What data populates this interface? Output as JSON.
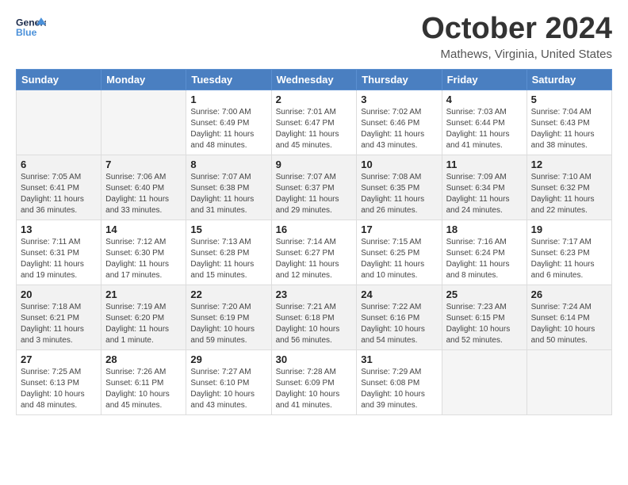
{
  "header": {
    "logo_general": "General",
    "logo_blue": "Blue",
    "month": "October 2024",
    "location": "Mathews, Virginia, United States"
  },
  "days_of_week": [
    "Sunday",
    "Monday",
    "Tuesday",
    "Wednesday",
    "Thursday",
    "Friday",
    "Saturday"
  ],
  "weeks": [
    [
      {
        "day": "",
        "sunrise": "",
        "sunset": "",
        "daylight": "",
        "empty": true
      },
      {
        "day": "",
        "sunrise": "",
        "sunset": "",
        "daylight": "",
        "empty": true
      },
      {
        "day": "1",
        "sunrise": "Sunrise: 7:00 AM",
        "sunset": "Sunset: 6:49 PM",
        "daylight": "Daylight: 11 hours and 48 minutes."
      },
      {
        "day": "2",
        "sunrise": "Sunrise: 7:01 AM",
        "sunset": "Sunset: 6:47 PM",
        "daylight": "Daylight: 11 hours and 45 minutes."
      },
      {
        "day": "3",
        "sunrise": "Sunrise: 7:02 AM",
        "sunset": "Sunset: 6:46 PM",
        "daylight": "Daylight: 11 hours and 43 minutes."
      },
      {
        "day": "4",
        "sunrise": "Sunrise: 7:03 AM",
        "sunset": "Sunset: 6:44 PM",
        "daylight": "Daylight: 11 hours and 41 minutes."
      },
      {
        "day": "5",
        "sunrise": "Sunrise: 7:04 AM",
        "sunset": "Sunset: 6:43 PM",
        "daylight": "Daylight: 11 hours and 38 minutes."
      }
    ],
    [
      {
        "day": "6",
        "sunrise": "Sunrise: 7:05 AM",
        "sunset": "Sunset: 6:41 PM",
        "daylight": "Daylight: 11 hours and 36 minutes."
      },
      {
        "day": "7",
        "sunrise": "Sunrise: 7:06 AM",
        "sunset": "Sunset: 6:40 PM",
        "daylight": "Daylight: 11 hours and 33 minutes."
      },
      {
        "day": "8",
        "sunrise": "Sunrise: 7:07 AM",
        "sunset": "Sunset: 6:38 PM",
        "daylight": "Daylight: 11 hours and 31 minutes."
      },
      {
        "day": "9",
        "sunrise": "Sunrise: 7:07 AM",
        "sunset": "Sunset: 6:37 PM",
        "daylight": "Daylight: 11 hours and 29 minutes."
      },
      {
        "day": "10",
        "sunrise": "Sunrise: 7:08 AM",
        "sunset": "Sunset: 6:35 PM",
        "daylight": "Daylight: 11 hours and 26 minutes."
      },
      {
        "day": "11",
        "sunrise": "Sunrise: 7:09 AM",
        "sunset": "Sunset: 6:34 PM",
        "daylight": "Daylight: 11 hours and 24 minutes."
      },
      {
        "day": "12",
        "sunrise": "Sunrise: 7:10 AM",
        "sunset": "Sunset: 6:32 PM",
        "daylight": "Daylight: 11 hours and 22 minutes."
      }
    ],
    [
      {
        "day": "13",
        "sunrise": "Sunrise: 7:11 AM",
        "sunset": "Sunset: 6:31 PM",
        "daylight": "Daylight: 11 hours and 19 minutes."
      },
      {
        "day": "14",
        "sunrise": "Sunrise: 7:12 AM",
        "sunset": "Sunset: 6:30 PM",
        "daylight": "Daylight: 11 hours and 17 minutes."
      },
      {
        "day": "15",
        "sunrise": "Sunrise: 7:13 AM",
        "sunset": "Sunset: 6:28 PM",
        "daylight": "Daylight: 11 hours and 15 minutes."
      },
      {
        "day": "16",
        "sunrise": "Sunrise: 7:14 AM",
        "sunset": "Sunset: 6:27 PM",
        "daylight": "Daylight: 11 hours and 12 minutes."
      },
      {
        "day": "17",
        "sunrise": "Sunrise: 7:15 AM",
        "sunset": "Sunset: 6:25 PM",
        "daylight": "Daylight: 11 hours and 10 minutes."
      },
      {
        "day": "18",
        "sunrise": "Sunrise: 7:16 AM",
        "sunset": "Sunset: 6:24 PM",
        "daylight": "Daylight: 11 hours and 8 minutes."
      },
      {
        "day": "19",
        "sunrise": "Sunrise: 7:17 AM",
        "sunset": "Sunset: 6:23 PM",
        "daylight": "Daylight: 11 hours and 6 minutes."
      }
    ],
    [
      {
        "day": "20",
        "sunrise": "Sunrise: 7:18 AM",
        "sunset": "Sunset: 6:21 PM",
        "daylight": "Daylight: 11 hours and 3 minutes."
      },
      {
        "day": "21",
        "sunrise": "Sunrise: 7:19 AM",
        "sunset": "Sunset: 6:20 PM",
        "daylight": "Daylight: 11 hours and 1 minute."
      },
      {
        "day": "22",
        "sunrise": "Sunrise: 7:20 AM",
        "sunset": "Sunset: 6:19 PM",
        "daylight": "Daylight: 10 hours and 59 minutes."
      },
      {
        "day": "23",
        "sunrise": "Sunrise: 7:21 AM",
        "sunset": "Sunset: 6:18 PM",
        "daylight": "Daylight: 10 hours and 56 minutes."
      },
      {
        "day": "24",
        "sunrise": "Sunrise: 7:22 AM",
        "sunset": "Sunset: 6:16 PM",
        "daylight": "Daylight: 10 hours and 54 minutes."
      },
      {
        "day": "25",
        "sunrise": "Sunrise: 7:23 AM",
        "sunset": "Sunset: 6:15 PM",
        "daylight": "Daylight: 10 hours and 52 minutes."
      },
      {
        "day": "26",
        "sunrise": "Sunrise: 7:24 AM",
        "sunset": "Sunset: 6:14 PM",
        "daylight": "Daylight: 10 hours and 50 minutes."
      }
    ],
    [
      {
        "day": "27",
        "sunrise": "Sunrise: 7:25 AM",
        "sunset": "Sunset: 6:13 PM",
        "daylight": "Daylight: 10 hours and 48 minutes."
      },
      {
        "day": "28",
        "sunrise": "Sunrise: 7:26 AM",
        "sunset": "Sunset: 6:11 PM",
        "daylight": "Daylight: 10 hours and 45 minutes."
      },
      {
        "day": "29",
        "sunrise": "Sunrise: 7:27 AM",
        "sunset": "Sunset: 6:10 PM",
        "daylight": "Daylight: 10 hours and 43 minutes."
      },
      {
        "day": "30",
        "sunrise": "Sunrise: 7:28 AM",
        "sunset": "Sunset: 6:09 PM",
        "daylight": "Daylight: 10 hours and 41 minutes."
      },
      {
        "day": "31",
        "sunrise": "Sunrise: 7:29 AM",
        "sunset": "Sunset: 6:08 PM",
        "daylight": "Daylight: 10 hours and 39 minutes."
      },
      {
        "day": "",
        "sunrise": "",
        "sunset": "",
        "daylight": "",
        "empty": true
      },
      {
        "day": "",
        "sunrise": "",
        "sunset": "",
        "daylight": "",
        "empty": true
      }
    ]
  ]
}
